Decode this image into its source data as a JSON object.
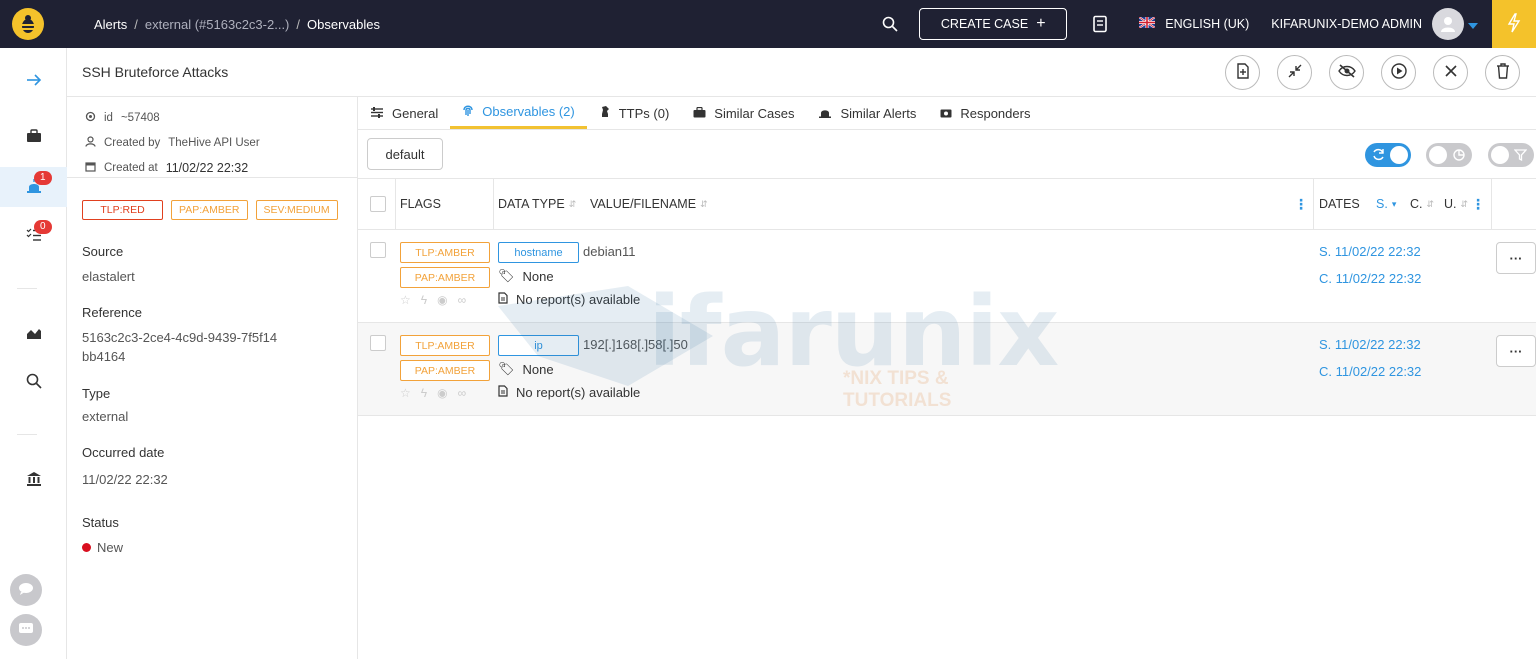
{
  "breadcrumb": {
    "root": "Alerts",
    "middle": "external (#5163c2c3-2...)",
    "current": "Observables"
  },
  "topbar": {
    "create_case_label": "CREATE CASE",
    "language": "ENGLISH (UK)",
    "user_name": "KIFARUNIX-DEMO ADMIN"
  },
  "nav": {
    "alerts_badge": "1",
    "tasks_badge": "0"
  },
  "alert": {
    "title": "SSH Bruteforce Attacks",
    "id_label": "id",
    "id_value": "~57408",
    "created_by_label": "Created by",
    "created_by_value": "TheHive API User",
    "created_at_label": "Created at",
    "created_at_value": "11/02/22 22:32",
    "tlp": "TLP:RED",
    "pap": "PAP:AMBER",
    "sev": "SEV:MEDIUM",
    "source_label": "Source",
    "source_value": "elastalert",
    "reference_label": "Reference",
    "reference_value": "5163c2c3-2ce4-4c9d-9439-7f5f14bb4164",
    "type_label": "Type",
    "type_value": "external",
    "occurred_label": "Occurred date",
    "occurred_value": "11/02/22 22:32",
    "status_label": "Status",
    "status_value": "New"
  },
  "tabs": [
    {
      "label": "General"
    },
    {
      "label": "Observables (2)"
    },
    {
      "label": "TTPs (0)"
    },
    {
      "label": "Similar Cases"
    },
    {
      "label": "Similar Alerts"
    },
    {
      "label": "Responders"
    }
  ],
  "toolbar": {
    "filter_label": "default"
  },
  "table": {
    "headers": {
      "flags": "FLAGS",
      "data_type": "DATA TYPE",
      "value": "VALUE/FILENAME",
      "dates": "DATES",
      "s": "S.",
      "c": "C.",
      "u": "U."
    },
    "rows": [
      {
        "tlp": "TLP:AMBER",
        "pap": "PAP:AMBER",
        "type": "hostname",
        "value": "debian11",
        "tags": "None",
        "reports": "No report(s) available",
        "s_date": "S. 11/02/22 22:32",
        "c_date": "C. 11/02/22 22:32"
      },
      {
        "tlp": "TLP:AMBER",
        "pap": "PAP:AMBER",
        "type": "ip",
        "value": "192[.]168[.]58[.]50",
        "tags": "None",
        "reports": "No report(s) available",
        "s_date": "S. 11/02/22 22:32",
        "c_date": "C. 11/02/22 22:32"
      }
    ]
  },
  "watermark": {
    "main": "ifarunix",
    "sub": "*NIX TIPS & TUTORIALS"
  },
  "colors": {
    "topbar": "#1f2133",
    "accent": "#2f95e0",
    "tlp_red": "#e0401f",
    "amber": "#f2a23a",
    "brand_yellow": "#f4c22b"
  }
}
